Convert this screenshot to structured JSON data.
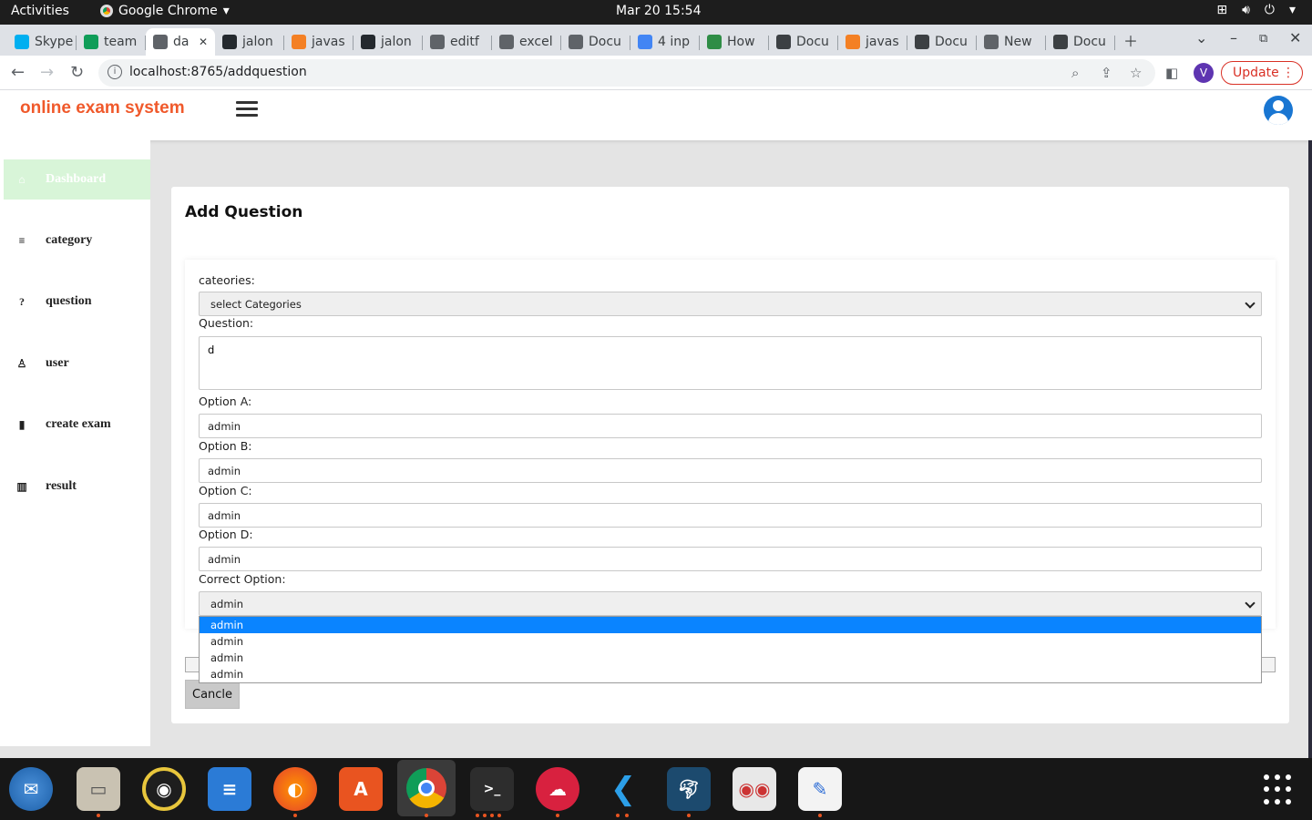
{
  "system": {
    "activities": "Activities",
    "app_name": "Google Chrome",
    "clock": "Mar 20  15:54"
  },
  "browser": {
    "tabs": [
      {
        "label": "Skype",
        "icon": "skype-icon",
        "color": "#00aff0"
      },
      {
        "label": "team",
        "icon": "sheets-icon",
        "color": "#0f9d58"
      },
      {
        "label": "da",
        "icon": "globe-icon",
        "color": "#5f6368",
        "active": true
      },
      {
        "label": "jalon",
        "icon": "github-icon",
        "color": "#24292e"
      },
      {
        "label": "javas",
        "icon": "stackoverflow-icon",
        "color": "#f48024"
      },
      {
        "label": "jalon",
        "icon": "github-icon",
        "color": "#24292e"
      },
      {
        "label": "editf",
        "icon": "globe-icon",
        "color": "#5f6368"
      },
      {
        "label": "excel",
        "icon": "globe-icon",
        "color": "#5f6368"
      },
      {
        "label": "Docu",
        "icon": "globe-icon",
        "color": "#5f6368"
      },
      {
        "label": "4 inp",
        "icon": "google-icon",
        "color": "#4285f4"
      },
      {
        "label": "How",
        "icon": "geeks-icon",
        "color": "#2f8d46"
      },
      {
        "label": "Docu",
        "icon": "docs-icon",
        "color": "#3c4043"
      },
      {
        "label": "javas",
        "icon": "stackoverflow-icon",
        "color": "#f48024"
      },
      {
        "label": "Docu",
        "icon": "docs-icon",
        "color": "#3c4043"
      },
      {
        "label": "New",
        "icon": "globe-icon",
        "color": "#5f6368"
      },
      {
        "label": "Docu",
        "icon": "docs-icon",
        "color": "#3c4043"
      }
    ],
    "url": "localhost:8765/addquestion",
    "profile_initial": "V",
    "update_label": "Update"
  },
  "app": {
    "brand": "online exam system",
    "brand_color": "#f0592b",
    "sidebar": [
      {
        "label": "Dashboard",
        "icon": "home-icon",
        "active": true
      },
      {
        "label": "category",
        "icon": "list-icon"
      },
      {
        "label": "question",
        "icon": "question-icon"
      },
      {
        "label": "user",
        "icon": "user-icon"
      },
      {
        "label": "create exam",
        "icon": "clipboard-icon"
      },
      {
        "label": "result",
        "icon": "chart-icon"
      }
    ]
  },
  "form": {
    "title": "Add Question",
    "categories_label": "cateories:",
    "categories_value": "select Categories",
    "question_label": "Question:",
    "question_value": "d",
    "option_a_label": "Option A:",
    "option_a_value": "admin",
    "option_b_label": "Option B:",
    "option_b_value": "admin",
    "option_c_label": "Option C:",
    "option_c_value": "admin",
    "option_d_label": "Option D:",
    "option_d_value": "admin",
    "correct_label": "Correct Option:",
    "correct_value": "admin",
    "correct_options": [
      "admin",
      "admin",
      "admin",
      "admin"
    ],
    "cancel_label": "Cancle"
  }
}
